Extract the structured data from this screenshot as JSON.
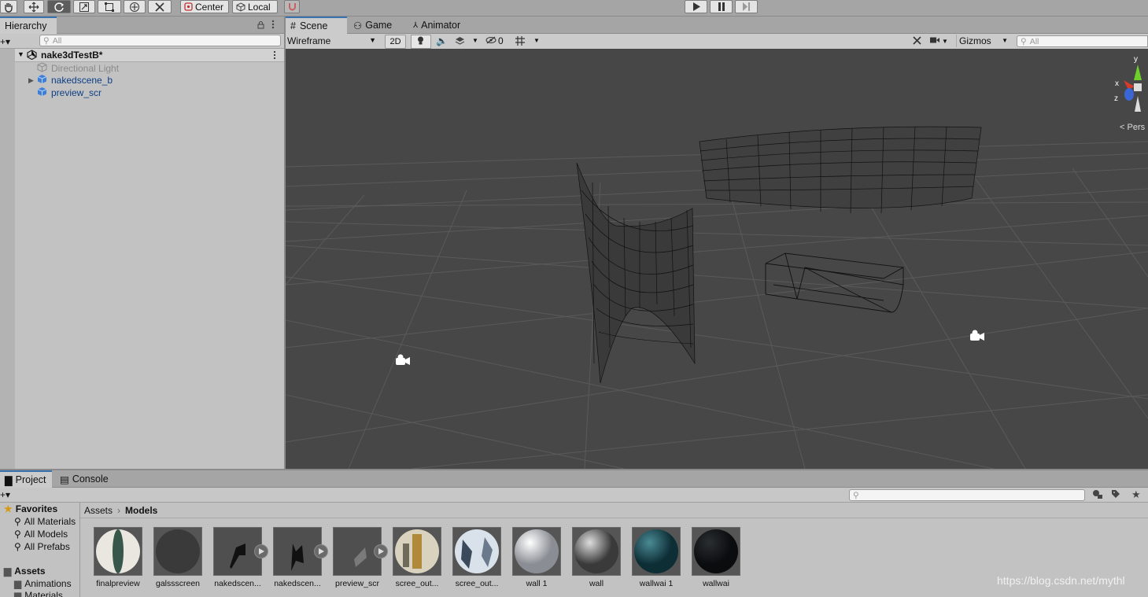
{
  "toolbar": {
    "tools": [
      "hand-tool",
      "move-tool",
      "rotate-tool",
      "scale-tool",
      "rect-tool",
      "transform-tool",
      "custom-tool"
    ],
    "pivot_label": "Center",
    "space_label": "Local"
  },
  "hierarchy": {
    "tab_label": "Hierarchy",
    "search_placeholder": "All",
    "scene_name": "nake3dTestB*",
    "items": [
      {
        "label": "Directional Light",
        "disabled": true
      },
      {
        "label": "nakedscene_b",
        "disabled": false
      },
      {
        "label": "preview_scr",
        "disabled": false
      }
    ]
  },
  "scene": {
    "tabs": [
      "Scene",
      "Game",
      "Animator"
    ],
    "draw_mode": "Wireframe",
    "btn_2d": "2D",
    "hidden_count": "0",
    "gizmos_label": "Gizmos",
    "search_placeholder": "All",
    "axis_labels": {
      "y": "y",
      "x": "x",
      "z": "z"
    },
    "projection_label": "Pers"
  },
  "project": {
    "tabs": [
      "Project",
      "Console"
    ],
    "favorites_label": "Favorites",
    "favorites": [
      "All Materials",
      "All Models",
      "All Prefabs"
    ],
    "assets_label": "Assets",
    "folders": [
      "Animations",
      "Materials"
    ],
    "breadcrumb": [
      "Assets",
      "Models"
    ],
    "assets": [
      {
        "label": "finalpreview",
        "kind": "material-green-stripe"
      },
      {
        "label": "galssscreen",
        "kind": "material-dark"
      },
      {
        "label": "nakedscen...",
        "kind": "model-a"
      },
      {
        "label": "nakedscen...",
        "kind": "model-b"
      },
      {
        "label": "preview_scr",
        "kind": "model-plane"
      },
      {
        "label": "scree_out...",
        "kind": "material-gold"
      },
      {
        "label": "scree_out...",
        "kind": "material-sky"
      },
      {
        "label": "wall 1",
        "kind": "material-light"
      },
      {
        "label": "wall",
        "kind": "material-grey"
      },
      {
        "label": "wallwai 1",
        "kind": "material-teal"
      },
      {
        "label": "wallwai",
        "kind": "material-black"
      }
    ]
  },
  "watermark": "https://blog.csdn.net/mythl",
  "colors": {
    "scene_bg": "#474747",
    "panel_bg": "#c2c2c2",
    "active_tab_accent": "#3a72b0",
    "link_blue": "#0d3f86"
  }
}
